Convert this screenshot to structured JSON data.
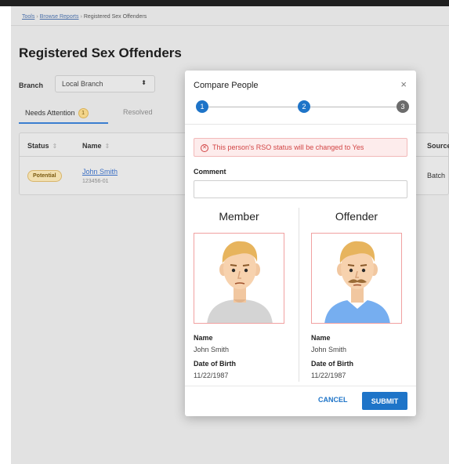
{
  "breadcrumb": {
    "items": [
      "Tools",
      "Browse Reports",
      "Registered Sex Offenders"
    ],
    "separator": "›"
  },
  "page": {
    "title": "Registered Sex Offenders"
  },
  "filters": {
    "branch_label": "Branch",
    "branch_value": "Local Branch"
  },
  "tabs": [
    {
      "label": "Needs Attention",
      "count": "1",
      "active": true
    },
    {
      "label": "Resolved",
      "active": false
    }
  ],
  "table": {
    "headers": {
      "status": "Status",
      "name": "Name",
      "source": "Source"
    },
    "rows": [
      {
        "status": "Potential",
        "name": "John Smith",
        "id": "123456-01",
        "source": "Batch"
      }
    ]
  },
  "modal": {
    "title": "Compare People",
    "close_glyph": "×",
    "steps": [
      "1",
      "2",
      "3"
    ],
    "current_step": 2,
    "alert": "This person's RSO status will be changed to Yes",
    "alert_glyph": "✕",
    "comment_label": "Comment",
    "comment_value": "",
    "member": {
      "heading": "Member",
      "name_label": "Name",
      "name": "John Smith",
      "dob_label": "Date of Birth",
      "dob": "11/22/1987"
    },
    "offender": {
      "heading": "Offender",
      "name_label": "Name",
      "name": "John Smith",
      "dob_label": "Date of Birth",
      "dob": "11/22/1987"
    },
    "cancel_label": "CANCEL",
    "submit_label": "SUBMIT"
  },
  "colors": {
    "primary": "#1e74c8",
    "step_inactive": "#6c6c6c",
    "alert_text": "#d24545",
    "alert_bg": "#fdecec",
    "pill_bg": "#f1dfb0",
    "portrait_border": "#f1a1a1"
  },
  "icons": {
    "sort": "sort-icon",
    "select_arrows": "chevron-updown-icon",
    "close": "close-icon",
    "alert": "error-circle-icon"
  }
}
